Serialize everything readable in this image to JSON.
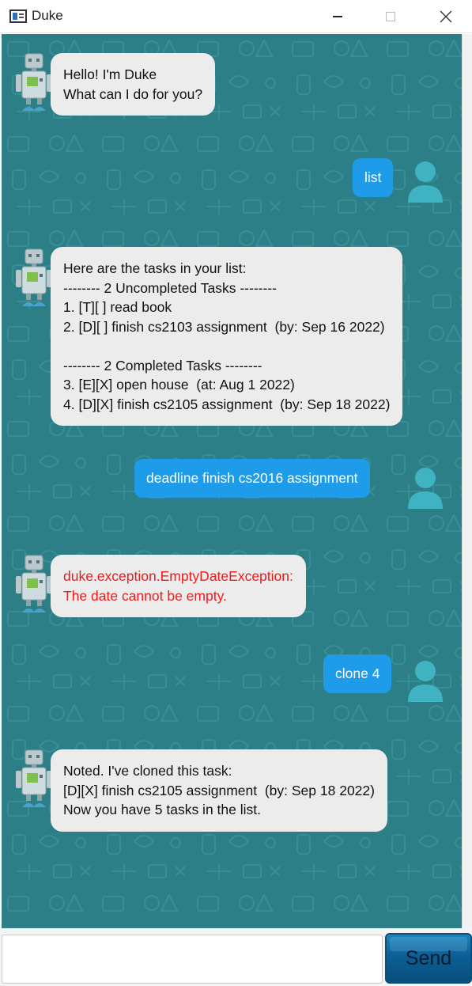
{
  "window": {
    "title": "Duke"
  },
  "chat": {
    "messages": [
      {
        "sender": "bot",
        "text": "Hello! I'm Duke\nWhat can I do for you?"
      },
      {
        "sender": "user",
        "text": "list"
      },
      {
        "sender": "bot",
        "text": "Here are the tasks in your list:\n-------- 2 Uncompleted Tasks --------\n1. [T][ ] read book\n2. [D][ ] finish cs2103 assignment  (by: Sep 16 2022)\n\n-------- 2 Completed Tasks --------\n3. [E][X] open house  (at: Aug 1 2022)\n4. [D][X] finish cs2105 assignment  (by: Sep 18 2022)"
      },
      {
        "sender": "user",
        "text": "deadline finish cs2016 assignment"
      },
      {
        "sender": "bot",
        "error": true,
        "text": "duke.exception.EmptyDateException:\nThe date cannot be empty."
      },
      {
        "sender": "user",
        "text": "clone 4"
      },
      {
        "sender": "bot",
        "text": "Noted. I've cloned this task:\n[D][X] finish cs2105 assignment  (by: Sep 18 2022)\nNow you have 5 tasks in the list."
      }
    ]
  },
  "input": {
    "value": "",
    "placeholder": ""
  },
  "send_button": {
    "label": "Send"
  },
  "colors": {
    "background": "#2c7f86",
    "bot_bubble": "#ececec",
    "user_bubble": "#1e9be9",
    "error_text": "#ee1b1b",
    "user_avatar": "#3fb3c1"
  },
  "icons": {
    "bot_avatar": "robot-icon",
    "user_avatar": "user-icon"
  }
}
